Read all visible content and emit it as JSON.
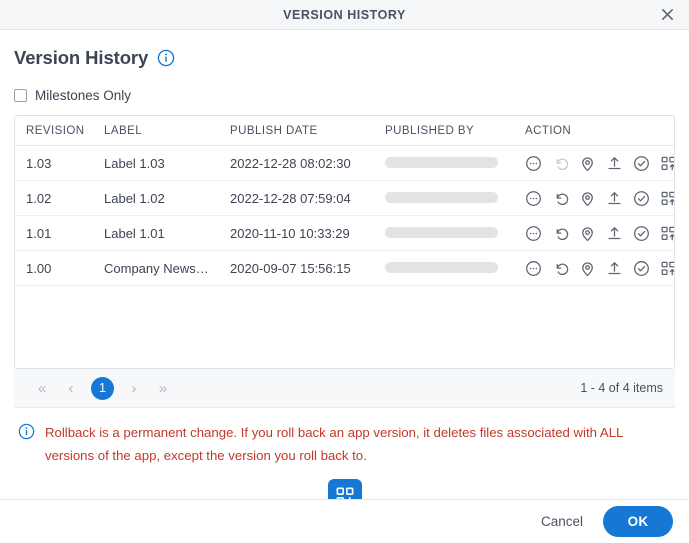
{
  "window": {
    "title": "VERSION HISTORY",
    "close_icon": "close-icon"
  },
  "heading": {
    "title": "Version History",
    "info_icon": "info-circle-icon"
  },
  "filter": {
    "milestones_only_label": "Milestones Only",
    "milestones_only_checked": false
  },
  "table": {
    "columns": [
      "REVISION",
      "LABEL",
      "PUBLISH DATE",
      "PUBLISHED BY",
      "ACTION"
    ],
    "rows": [
      {
        "revision": "1.03",
        "label": "Label 1.03",
        "publish_date": "2022-12-28 08:02:30",
        "published_by": "",
        "published_by_redacted": true,
        "rollback_disabled": true
      },
      {
        "revision": "1.02",
        "label": "Label 1.02",
        "publish_date": "2022-12-28 07:59:04",
        "published_by": "",
        "published_by_redacted": true,
        "rollback_disabled": false
      },
      {
        "revision": "1.01",
        "label": "Label 1.01",
        "publish_date": "2020-11-10 10:33:29",
        "published_by": "",
        "published_by_redacted": true,
        "rollback_disabled": false
      },
      {
        "revision": "1.00",
        "label": "Company News…",
        "publish_date": "2020-09-07 15:56:15",
        "published_by": "",
        "published_by_redacted": true,
        "rollback_disabled": false
      }
    ],
    "action_icons": [
      "more-options-icon",
      "rollback-icon",
      "location-pin-icon",
      "upload-icon",
      "check-circle-icon",
      "add-to-grid-icon"
    ]
  },
  "pagination": {
    "first_label": "«",
    "prev_label": "‹",
    "current_page": "1",
    "next_label": "›",
    "last_label": "»",
    "count_text": "1 - 4 of 4 items"
  },
  "warning": {
    "icon": "info-circle-icon",
    "text": "Rollback is a permanent change. If you roll back an app version, it deletes files associated with ALL versions of the app, except the version you roll back to.",
    "color": "#c0392b"
  },
  "fab": {
    "icon": "add-grid-icon",
    "color": "#1678d4"
  },
  "footer": {
    "cancel_label": "Cancel",
    "ok_label": "OK",
    "accent_color": "#1678d4"
  }
}
